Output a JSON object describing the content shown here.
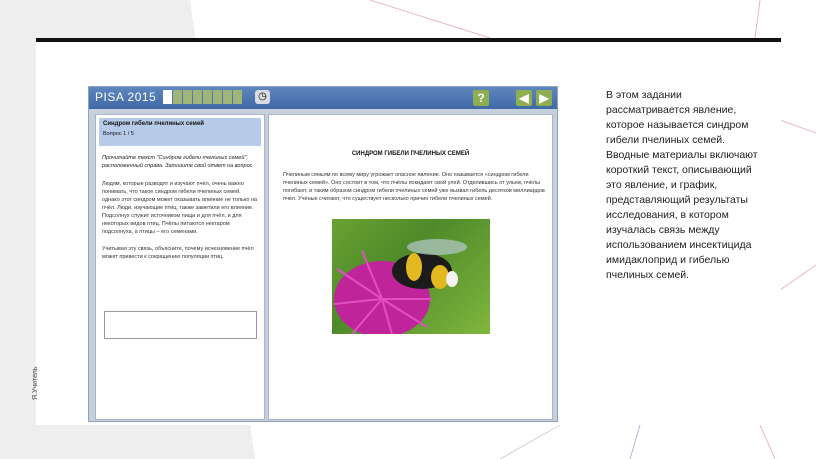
{
  "slide": {
    "side_label": "Я.Учитель",
    "description": "В этом задании рассматривается явление, которое называется синдром гибели пчелиных семей. Вводные материалы включают короткий текст, описывающий это явление, и график, представляющий результаты исследования, в котором изучалась связь между использованием инсектицида имидаклоприд и гибелью пчелиных семей."
  },
  "pisa": {
    "title": "PISA 2015",
    "progress": {
      "total": 8,
      "current": 1
    },
    "clock_icon": "clock-icon",
    "help_label": "?",
    "prev_label": "◀",
    "next_label": "▶",
    "left_panel": {
      "question_title": "Синдром гибели пчелиных семей",
      "question_number": "Вопрос 1 / 5",
      "instruction": "Прочитайте текст \"Синдром гибели пчелиных семей\", расположенный справа. Запишите свой ответ на вопрос.",
      "intro": "Людям, которые разводят и изучают пчёл, очень важно понимать, что такое синдром гибели пчелиных семей, однако этот синдром может оказывать влияние не только на пчёл. Люди, изучающие птиц, также заметили его влияние. Подсолнух служит источником пищи и для пчёл, и для некоторых видов птиц. Пчёлы питаются нектаром подсолнуха, а птицы – его семенами.",
      "question": "Учитывая эту связь, объясните, почему исчезновение пчёл может привести к сокращению популяции птиц."
    },
    "right_panel": {
      "title": "СИНДРОМ ГИБЕЛИ ПЧЕЛИНЫХ СЕМЕЙ",
      "text": "Пчелиным семьям по всему миру угрожает опасное явление. Оно называется «синдром гибели пчелиных семей». Оно состоит в том, что пчёлы покидают свой улей. Отделившись от ульев, пчёлы погибают, и таким образом синдром гибели пчелиных семей уже вызвал гибель десятков миллиардов пчёл. Учёные считают, что существует несколько причин гибели пчелиных семей."
    }
  }
}
